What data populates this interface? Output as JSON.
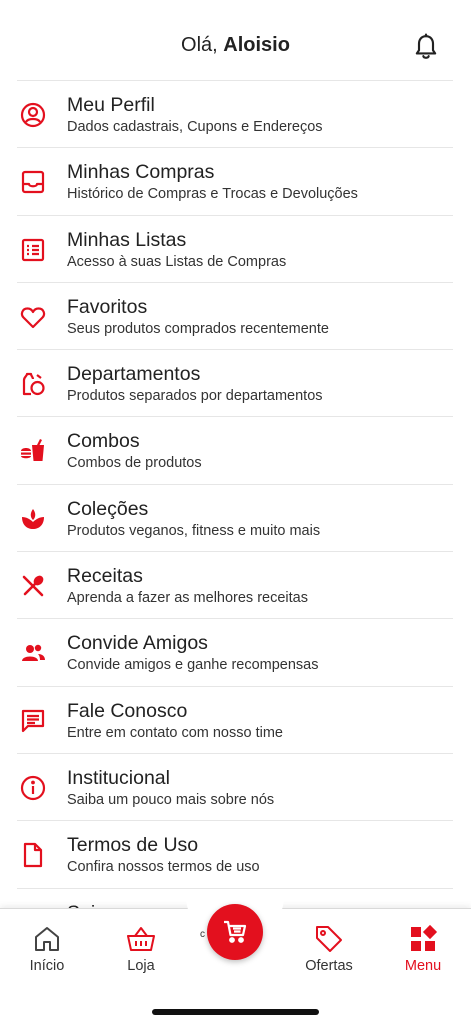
{
  "header": {
    "greeting_prefix": "Olá,",
    "user_name": "Aloisio",
    "bell_icon": "bell-icon"
  },
  "colors": {
    "accent": "#e3101e",
    "text": "#222222",
    "divider": "#e6e6e6"
  },
  "menu": {
    "items": [
      {
        "title": "Meu Perfil",
        "subtitle": "Dados cadastrais, Cupons e Endereços",
        "icon": "user-circle-icon"
      },
      {
        "title": "Minhas Compras",
        "subtitle": "Histórico de Compras e Trocas e Devoluções",
        "icon": "inbox-tray-icon"
      },
      {
        "title": "Minhas Listas",
        "subtitle": "Acesso à suas Listas de Compras",
        "icon": "list-icon"
      },
      {
        "title": "Favoritos",
        "subtitle": "Seus produtos comprados recentemente",
        "icon": "heart-icon"
      },
      {
        "title": "Departamentos",
        "subtitle": "Produtos separados por departamentos",
        "icon": "departments-icon"
      },
      {
        "title": "Combos",
        "subtitle": "Combos de produtos",
        "icon": "combo-food-icon"
      },
      {
        "title": "Coleções",
        "subtitle": "Produtos veganos, fitness e muito mais",
        "icon": "leaf-drop-icon"
      },
      {
        "title": "Receitas",
        "subtitle": "Aprenda a fazer as melhores receitas",
        "icon": "utensils-icon"
      },
      {
        "title": "Convide Amigos",
        "subtitle": "Convide amigos e ganhe recompensas",
        "icon": "people-icon"
      },
      {
        "title": "Fale Conosco",
        "subtitle": "Entre em contato com nosso time",
        "icon": "chat-icon"
      },
      {
        "title": "Institucional",
        "subtitle": "Saiba um pouco mais sobre nós",
        "icon": "info-icon"
      },
      {
        "title": "Termos de Uso",
        "subtitle": "Confira nossos termos de uso",
        "icon": "document-icon"
      }
    ],
    "partial_item_title": "Sair"
  },
  "bottom_nav": {
    "items": [
      {
        "label": "Início",
        "icon": "home-icon"
      },
      {
        "label": "Loja",
        "icon": "basket-icon"
      },
      {
        "label": "Ofertas",
        "icon": "tag-icon"
      },
      {
        "label": "Menu",
        "icon": "grid-menu-icon",
        "active": true
      }
    ],
    "cart_icon": "cart-icon"
  }
}
